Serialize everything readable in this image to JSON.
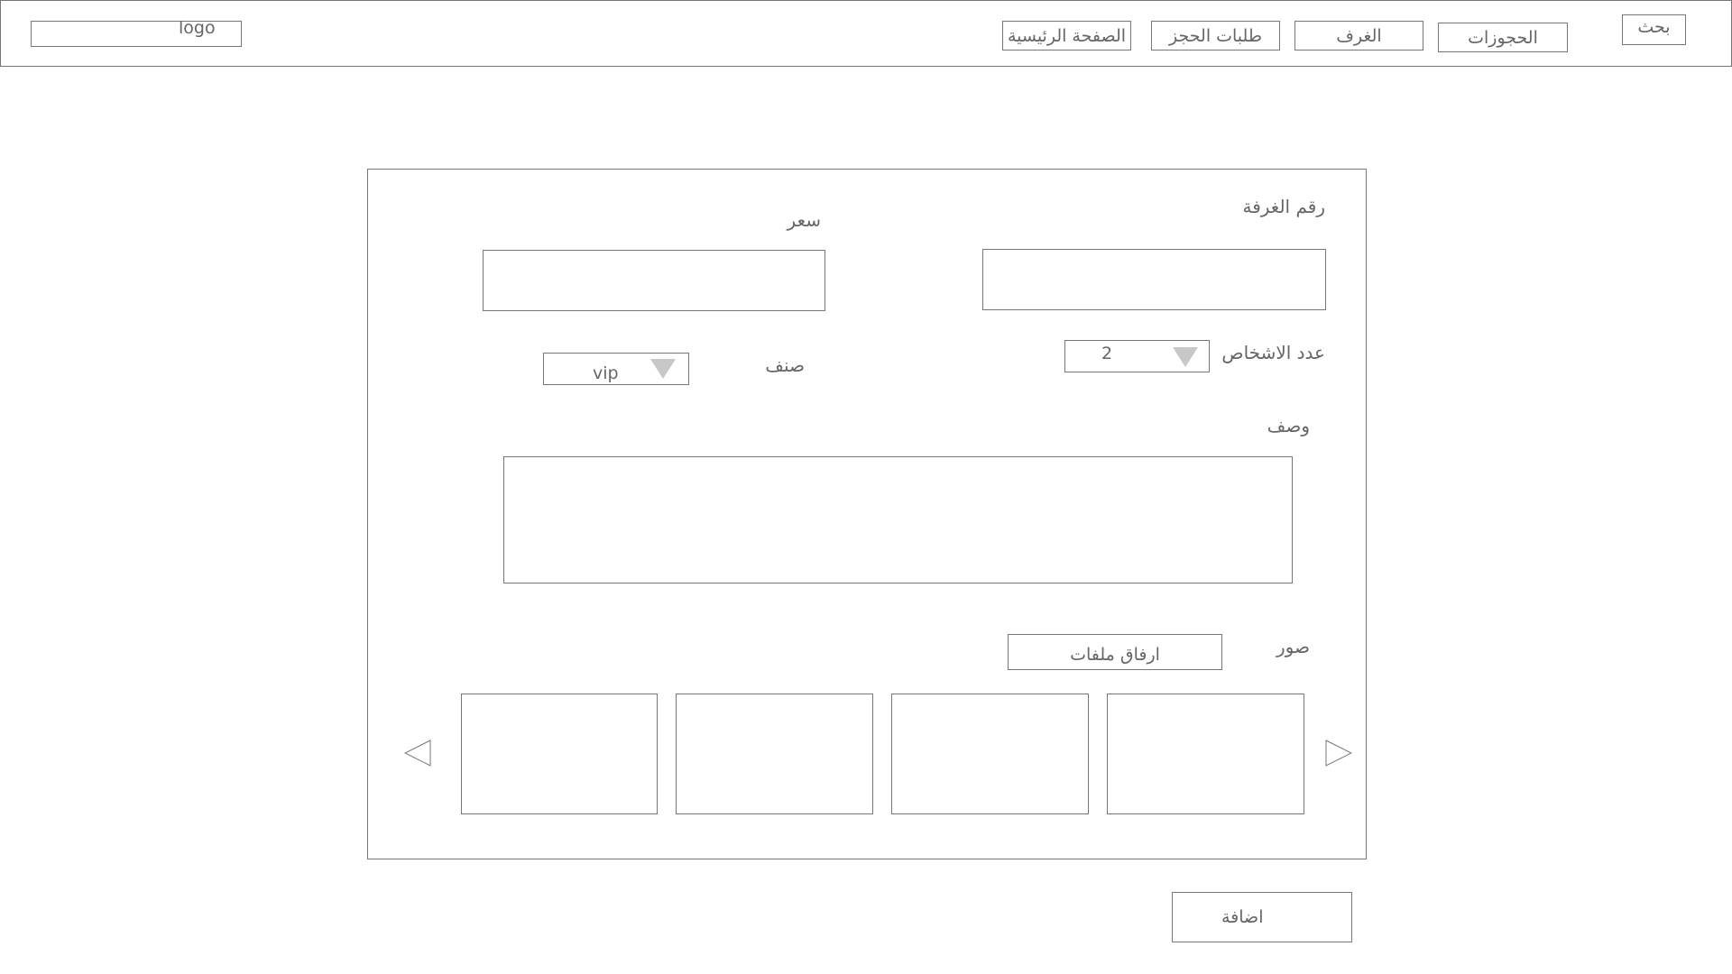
{
  "header": {
    "logo": "logo",
    "nav": [
      "الصفحة الرئيسية",
      "طلبات الحجز",
      "الغرف",
      "الحجوزات"
    ],
    "search": "بحث"
  },
  "form": {
    "room_number_label": "رقم الغرفة",
    "room_number_value": "",
    "price_label": "سعر",
    "price_value": "",
    "persons_label": "عدد الاشخاص",
    "persons_value": "2",
    "category_label": "صنف",
    "category_value": "vip",
    "description_label": "وصف",
    "description_value": "",
    "images_label": "صور",
    "attach_button": "ارفاق ملفات"
  },
  "add_button": "اضافة"
}
